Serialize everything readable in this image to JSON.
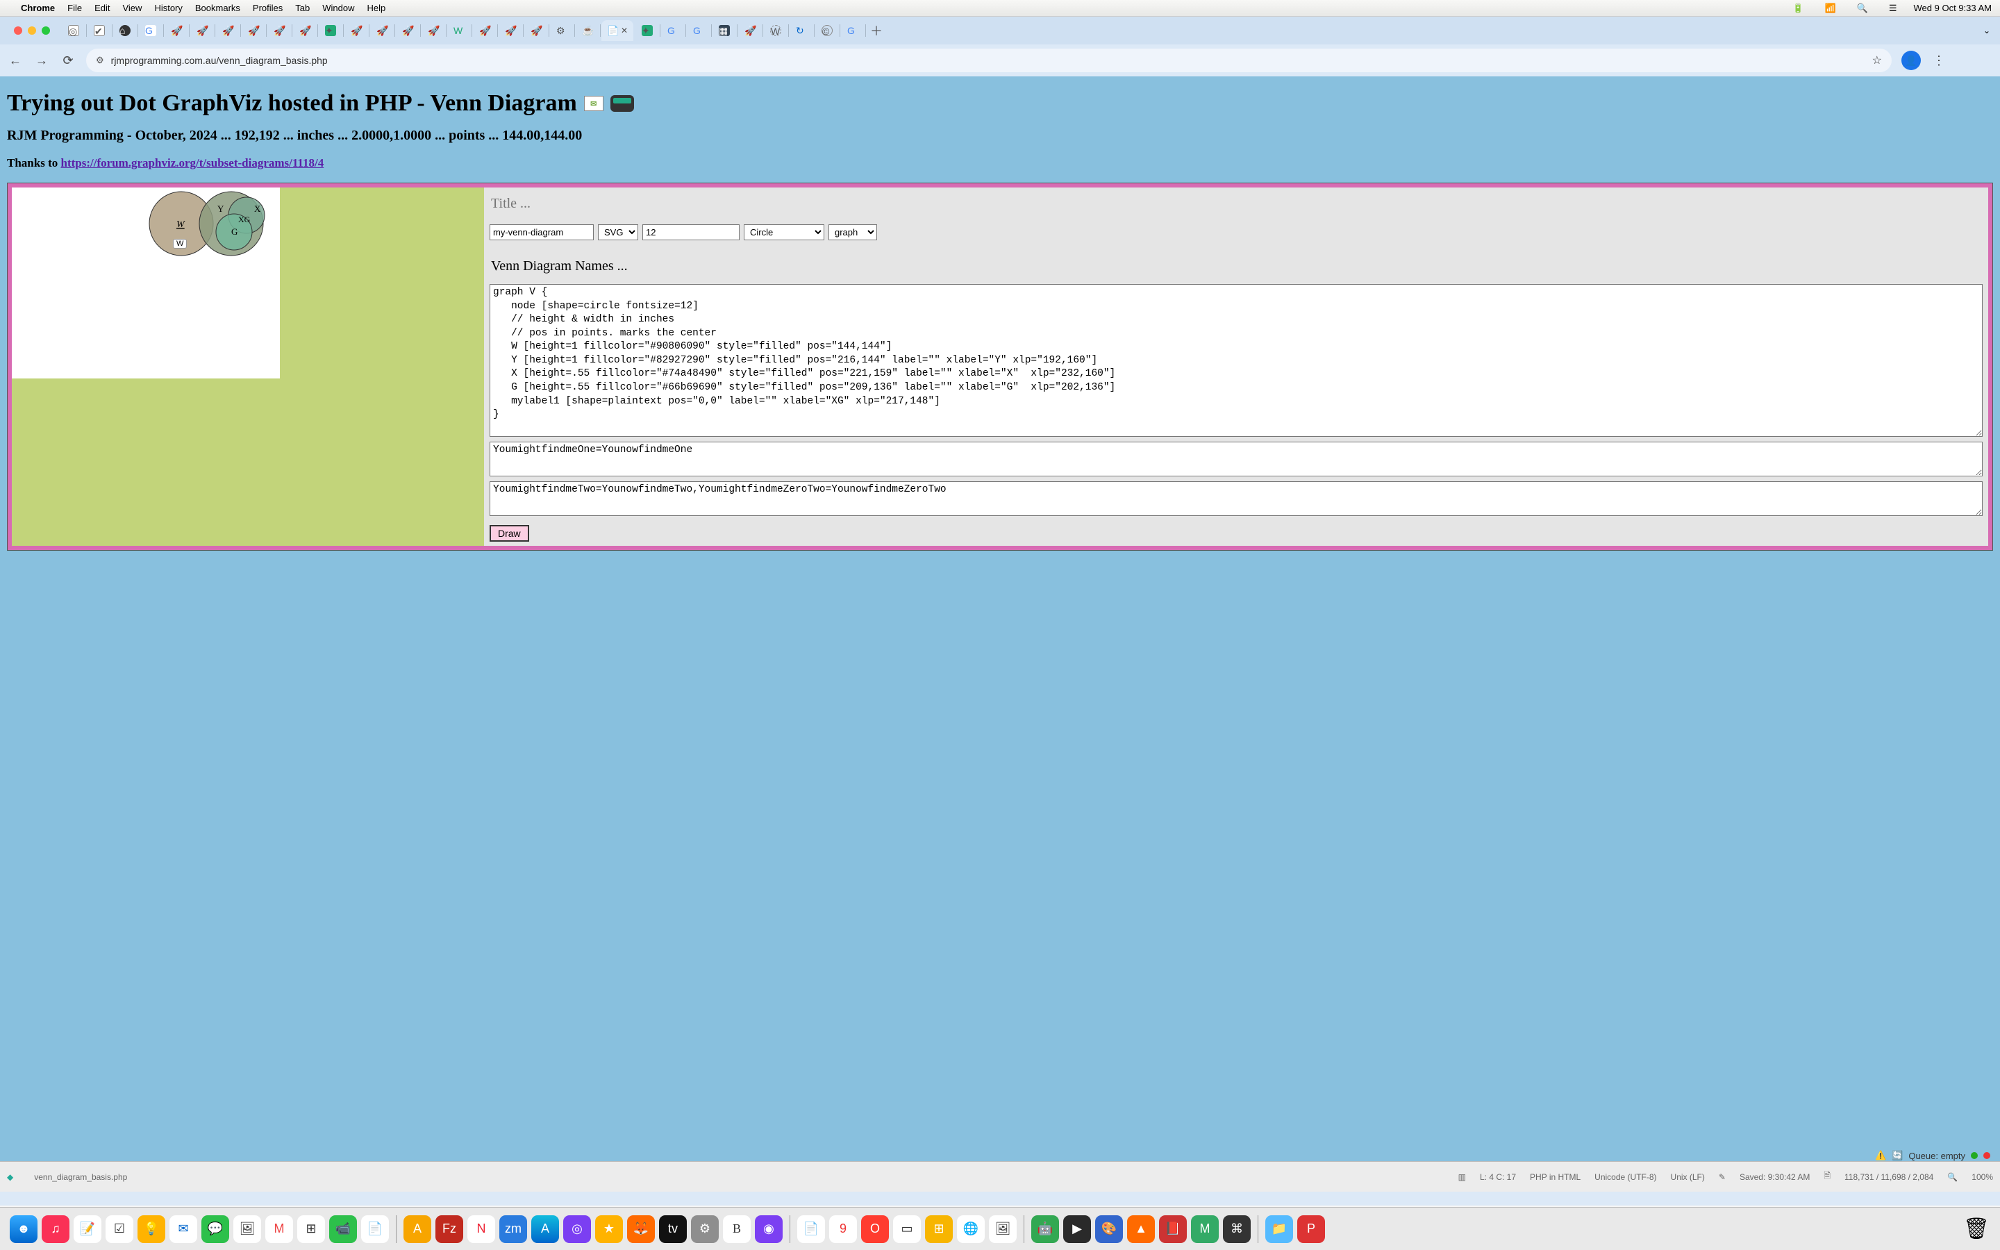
{
  "menubar": {
    "appname": "Chrome",
    "items": [
      "File",
      "Edit",
      "View",
      "History",
      "Bookmarks",
      "Profiles",
      "Tab",
      "Window",
      "Help"
    ],
    "clock": "Wed 9 Oct  9:33 AM"
  },
  "urlbar": {
    "url": "rjmprogramming.com.au/venn_diagram_basis.php"
  },
  "page": {
    "title": "Trying out Dot GraphViz hosted in PHP - Venn Diagram",
    "subtitle": "RJM Programming - October, 2024 ... 192,192 ... inches ... 2.0000,1.0000 ... points ... 144.00,144.00",
    "thanks_label": "Thanks to ",
    "thanks_link": "https://forum.graphviz.org/t/subset-diagrams/1118/4"
  },
  "panel": {
    "title_placeholder": "Title ...",
    "filename_value": "my-venn-diagram",
    "format_options": [
      "SVG"
    ],
    "fontsize_value": "12",
    "shape_options": [
      "Circle"
    ],
    "layout_options": [
      "graph"
    ],
    "names_header": "Venn Diagram Names ...",
    "dot_source": "graph V {\n   node [shape=circle fontsize=12]\n   // height & width in inches\n   // pos in points. marks the center\n   W [height=1 fillcolor=\"#90806090\" style=\"filled\" pos=\"144,144\"]\n   Y [height=1 fillcolor=\"#82927290\" style=\"filled\" pos=\"216,144\" label=\"\" xlabel=\"Y\" xlp=\"192,160\"]\n   X [height=.55 fillcolor=\"#74a48490\" style=\"filled\" pos=\"221,159\" label=\"\" xlabel=\"X\"  xlp=\"232,160\"]\n   G [height=.55 fillcolor=\"#66b69690\" style=\"filled\" pos=\"209,136\" label=\"\" xlabel=\"G\"  xlp=\"202,136\"]\n   mylabel1 [shape=plaintext pos=\"0,0\" label=\"\" xlabel=\"XG\" xlp=\"217,148\"]\n}",
    "fixup1": "YoumightfindmeOne=YounowfindmeOne",
    "fixup2": "YoumightfindmeTwo=YounowfindmeTwo,YoumightfindmeZeroTwo=YounowfindmeZeroTwo",
    "draw_label": "Draw"
  },
  "venn": {
    "W": {
      "label": "W"
    },
    "Y": {
      "label": "Y"
    },
    "X": {
      "label": "X"
    },
    "G": {
      "label": "G"
    },
    "XG": {
      "label": "XG"
    },
    "w_button": "W"
  },
  "statusbar": {
    "file_tab": "venn_diagram_basis.php",
    "cursor": "L: 4 C: 17",
    "lang": "PHP in HTML",
    "encoding": "Unicode (UTF-8)",
    "lineend": "Unix (LF)",
    "saved": "Saved: 9:30:42 AM",
    "counts": "118,731 / 11,698 / 2,084",
    "zoom": "100%",
    "queue": "Queue: empty"
  }
}
